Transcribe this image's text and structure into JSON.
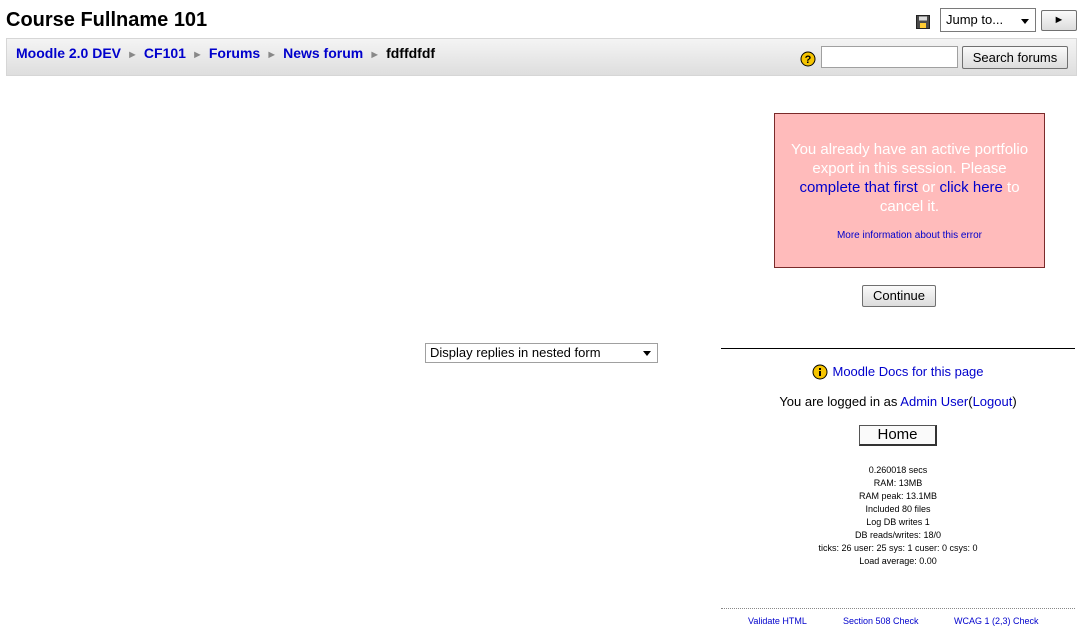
{
  "header": {
    "course_title": "Course Fullname 101",
    "save_icon": "save-icon",
    "jump_select": {
      "selected": "Jump to..."
    },
    "jump_go_glyph": "►"
  },
  "navbar": {
    "breadcrumb": [
      {
        "label": "Moodle 2.0 DEV",
        "link": true
      },
      {
        "label": "CF101",
        "link": true
      },
      {
        "label": "Forums",
        "link": true
      },
      {
        "label": "News forum",
        "link": true
      },
      {
        "label": "fdffdfdf",
        "link": false
      }
    ],
    "separator": "►",
    "search": {
      "value": "",
      "button_label": "Search forums"
    }
  },
  "error": {
    "text_1": "You already have an active portfolio export in this session. Please",
    "link_1": "complete that first",
    "text_2": "or",
    "link_2": "click here",
    "text_3": "to cancel it.",
    "more_info": "More information about this error",
    "continue_label": "Continue"
  },
  "display_mode": {
    "selected": "Display replies in nested form"
  },
  "footer": {
    "docs_link": "Moodle Docs for this page",
    "login_prefix": "You are logged in as",
    "user_name": "Admin User",
    "logout_label": "Logout",
    "home_label": "Home",
    "perf": [
      "0.260018 secs",
      "RAM: 13MB",
      "RAM peak: 13.1MB",
      "Included 80 files",
      "Log DB writes 1",
      "DB reads/writes: 18/0",
      "ticks: 26 user: 25 sys: 1 cuser: 0 csys: 0",
      "Load average: 0.00"
    ],
    "validators": [
      "Validate HTML",
      "Section 508 Check",
      "WCAG 1 (2,3) Check"
    ]
  },
  "colors": {
    "link": "#0000cc",
    "error_bg": "#ffbbbb",
    "error_border": "#7a2a2a",
    "error_text": "#ffffff",
    "help_icon": "#f5c400"
  }
}
